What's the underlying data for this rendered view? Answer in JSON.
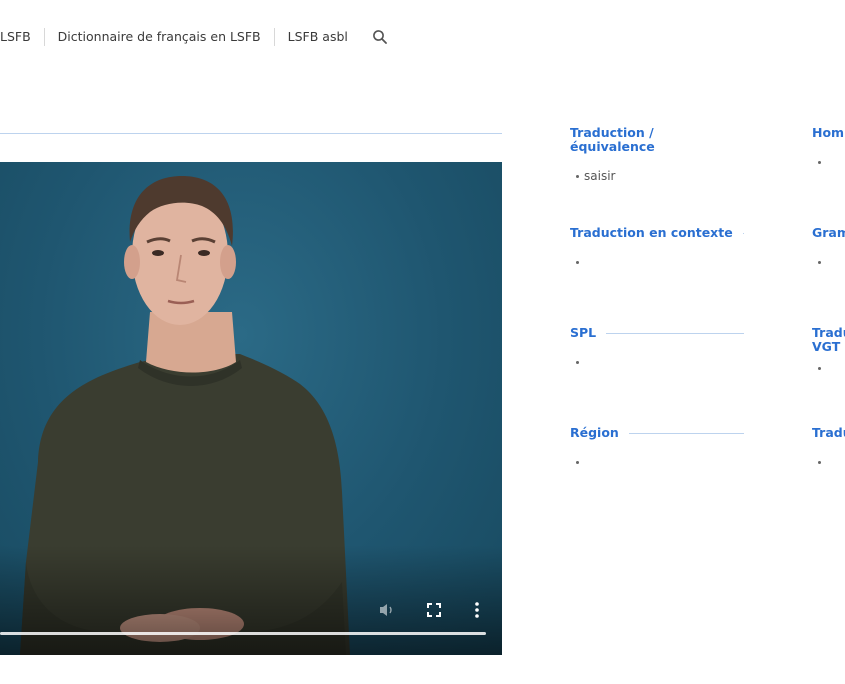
{
  "nav": {
    "items": [
      "LSFB",
      "Dictionnaire de français en LSFB",
      "LSFB asbl"
    ],
    "search_icon": "search-icon"
  },
  "colors": {
    "accent": "#2a6fd1",
    "rule": "#bdd3ee",
    "video_bg": "#1f5670"
  },
  "video": {
    "controls": [
      "volume-icon",
      "fullscreen-icon",
      "more-vert-icon"
    ]
  },
  "sections_left": [
    {
      "heading": "Traduction / équivalence",
      "items": [
        "saisir"
      ]
    },
    {
      "heading": "Traduction en contexte",
      "items": [
        ""
      ]
    },
    {
      "heading": "SPL",
      "items": [
        ""
      ]
    },
    {
      "heading": "Région",
      "items": [
        ""
      ]
    }
  ],
  "sections_right": [
    {
      "heading_lines": [
        "Hom"
      ],
      "items": [
        ""
      ]
    },
    {
      "heading_lines": [
        "Gram"
      ],
      "items": [
        ""
      ]
    },
    {
      "heading_lines": [
        "Tradu",
        "VGT"
      ],
      "items": [
        ""
      ]
    },
    {
      "heading_lines": [
        "Tradu"
      ],
      "items": [
        ""
      ]
    }
  ]
}
